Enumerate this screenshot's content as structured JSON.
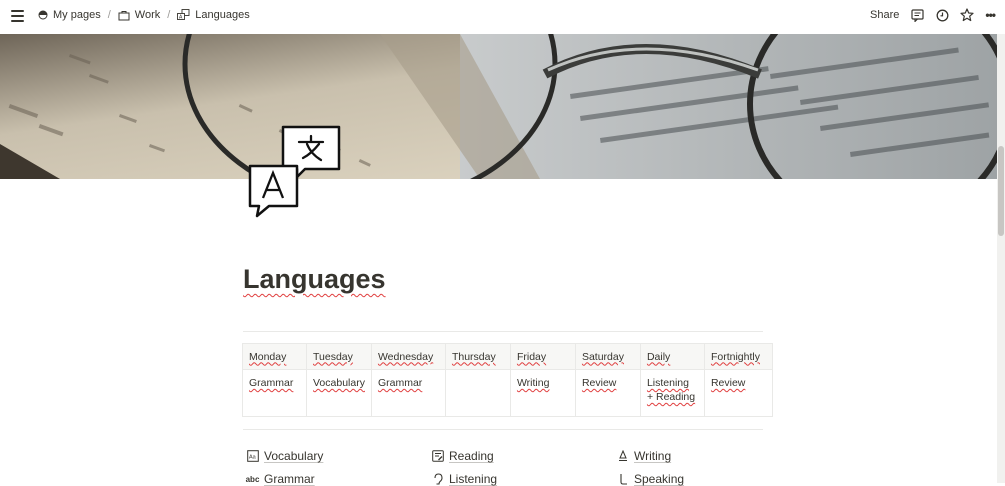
{
  "breadcrumbs": [
    {
      "label": "My pages",
      "icon": "half-circle-icon"
    },
    {
      "label": "Work",
      "icon": "briefcase-icon"
    },
    {
      "label": "Languages",
      "icon": "translate-icon"
    }
  ],
  "topbar": {
    "share_label": "Share",
    "more_label": "•••"
  },
  "page": {
    "title": "Languages",
    "icon": "translate-speech-bubbles"
  },
  "schedule": {
    "headers": [
      "Monday",
      "Tuesday",
      "Wednesday",
      "Thursday",
      "Friday",
      "Saturday",
      "Daily",
      "Fortnightly"
    ],
    "row": [
      "Grammar",
      "Vocabulary",
      "Grammar",
      "",
      "Writing",
      "Review",
      "Listening",
      "Review"
    ],
    "daily_extra": "+ Reading"
  },
  "links": [
    {
      "label": "Vocabulary",
      "icon": "dictionary-icon"
    },
    {
      "label": "Reading",
      "icon": "notepad-icon"
    },
    {
      "label": "Writing",
      "icon": "pen-icon"
    },
    {
      "label": "Grammar",
      "icon": "abc-icon"
    },
    {
      "label": "Listening",
      "icon": "ear-icon"
    },
    {
      "label": "Speaking",
      "icon": "speaking-icon"
    }
  ],
  "colors": {
    "text": "#37352f",
    "spellcheck": "#e03e3e",
    "border": "#e9e9e7",
    "header_bg": "#f7f7f5"
  }
}
